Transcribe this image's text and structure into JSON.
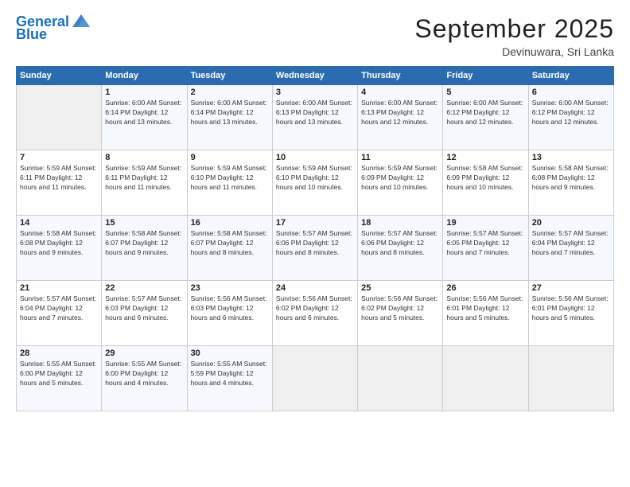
{
  "header": {
    "logo_line1": "General",
    "logo_line2": "Blue",
    "title": "September 2025",
    "subtitle": "Devinuwara, Sri Lanka"
  },
  "days_of_week": [
    "Sunday",
    "Monday",
    "Tuesday",
    "Wednesday",
    "Thursday",
    "Friday",
    "Saturday"
  ],
  "weeks": [
    [
      {
        "day": "",
        "info": ""
      },
      {
        "day": "1",
        "info": "Sunrise: 6:00 AM\nSunset: 6:14 PM\nDaylight: 12 hours\nand 13 minutes."
      },
      {
        "day": "2",
        "info": "Sunrise: 6:00 AM\nSunset: 6:14 PM\nDaylight: 12 hours\nand 13 minutes."
      },
      {
        "day": "3",
        "info": "Sunrise: 6:00 AM\nSunset: 6:13 PM\nDaylight: 12 hours\nand 13 minutes."
      },
      {
        "day": "4",
        "info": "Sunrise: 6:00 AM\nSunset: 6:13 PM\nDaylight: 12 hours\nand 12 minutes."
      },
      {
        "day": "5",
        "info": "Sunrise: 6:00 AM\nSunset: 6:12 PM\nDaylight: 12 hours\nand 12 minutes."
      },
      {
        "day": "6",
        "info": "Sunrise: 6:00 AM\nSunset: 6:12 PM\nDaylight: 12 hours\nand 12 minutes."
      }
    ],
    [
      {
        "day": "7",
        "info": "Sunrise: 5:59 AM\nSunset: 6:11 PM\nDaylight: 12 hours\nand 11 minutes."
      },
      {
        "day": "8",
        "info": "Sunrise: 5:59 AM\nSunset: 6:11 PM\nDaylight: 12 hours\nand 11 minutes."
      },
      {
        "day": "9",
        "info": "Sunrise: 5:59 AM\nSunset: 6:10 PM\nDaylight: 12 hours\nand 11 minutes."
      },
      {
        "day": "10",
        "info": "Sunrise: 5:59 AM\nSunset: 6:10 PM\nDaylight: 12 hours\nand 10 minutes."
      },
      {
        "day": "11",
        "info": "Sunrise: 5:59 AM\nSunset: 6:09 PM\nDaylight: 12 hours\nand 10 minutes."
      },
      {
        "day": "12",
        "info": "Sunrise: 5:58 AM\nSunset: 6:09 PM\nDaylight: 12 hours\nand 10 minutes."
      },
      {
        "day": "13",
        "info": "Sunrise: 5:58 AM\nSunset: 6:08 PM\nDaylight: 12 hours\nand 9 minutes."
      }
    ],
    [
      {
        "day": "14",
        "info": "Sunrise: 5:58 AM\nSunset: 6:08 PM\nDaylight: 12 hours\nand 9 minutes."
      },
      {
        "day": "15",
        "info": "Sunrise: 5:58 AM\nSunset: 6:07 PM\nDaylight: 12 hours\nand 9 minutes."
      },
      {
        "day": "16",
        "info": "Sunrise: 5:58 AM\nSunset: 6:07 PM\nDaylight: 12 hours\nand 8 minutes."
      },
      {
        "day": "17",
        "info": "Sunrise: 5:57 AM\nSunset: 6:06 PM\nDaylight: 12 hours\nand 8 minutes."
      },
      {
        "day": "18",
        "info": "Sunrise: 5:57 AM\nSunset: 6:06 PM\nDaylight: 12 hours\nand 8 minutes."
      },
      {
        "day": "19",
        "info": "Sunrise: 5:57 AM\nSunset: 6:05 PM\nDaylight: 12 hours\nand 7 minutes."
      },
      {
        "day": "20",
        "info": "Sunrise: 5:57 AM\nSunset: 6:04 PM\nDaylight: 12 hours\nand 7 minutes."
      }
    ],
    [
      {
        "day": "21",
        "info": "Sunrise: 5:57 AM\nSunset: 6:04 PM\nDaylight: 12 hours\nand 7 minutes."
      },
      {
        "day": "22",
        "info": "Sunrise: 5:57 AM\nSunset: 6:03 PM\nDaylight: 12 hours\nand 6 minutes."
      },
      {
        "day": "23",
        "info": "Sunrise: 5:56 AM\nSunset: 6:03 PM\nDaylight: 12 hours\nand 6 minutes."
      },
      {
        "day": "24",
        "info": "Sunrise: 5:56 AM\nSunset: 6:02 PM\nDaylight: 12 hours\nand 6 minutes."
      },
      {
        "day": "25",
        "info": "Sunrise: 5:56 AM\nSunset: 6:02 PM\nDaylight: 12 hours\nand 5 minutes."
      },
      {
        "day": "26",
        "info": "Sunrise: 5:56 AM\nSunset: 6:01 PM\nDaylight: 12 hours\nand 5 minutes."
      },
      {
        "day": "27",
        "info": "Sunrise: 5:56 AM\nSunset: 6:01 PM\nDaylight: 12 hours\nand 5 minutes."
      }
    ],
    [
      {
        "day": "28",
        "info": "Sunrise: 5:55 AM\nSunset: 6:00 PM\nDaylight: 12 hours\nand 5 minutes."
      },
      {
        "day": "29",
        "info": "Sunrise: 5:55 AM\nSunset: 6:00 PM\nDaylight: 12 hours\nand 4 minutes."
      },
      {
        "day": "30",
        "info": "Sunrise: 5:55 AM\nSunset: 5:59 PM\nDaylight: 12 hours\nand 4 minutes."
      },
      {
        "day": "",
        "info": ""
      },
      {
        "day": "",
        "info": ""
      },
      {
        "day": "",
        "info": ""
      },
      {
        "day": "",
        "info": ""
      }
    ]
  ]
}
